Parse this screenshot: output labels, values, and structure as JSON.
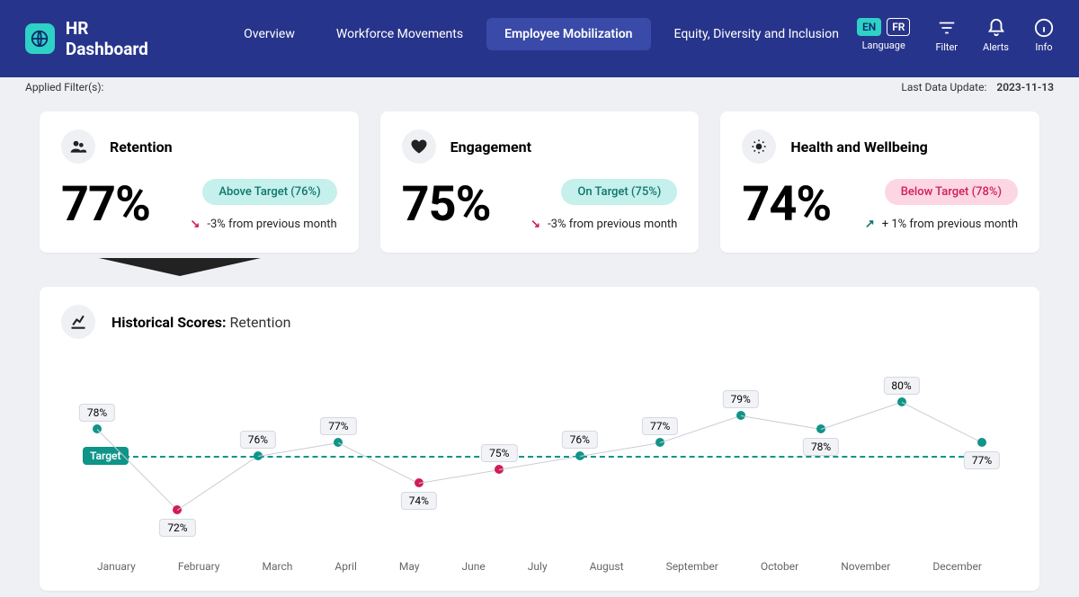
{
  "app_title": "HR Dashboard",
  "nav": {
    "items": [
      "Overview",
      "Workforce Movements",
      "Employee Mobilization",
      "Equity, Diversity and Inclusion"
    ],
    "active_index": 2
  },
  "lang": {
    "en": "EN",
    "fr": "FR",
    "label": "Language"
  },
  "top_icons": {
    "filter": "Filter",
    "alerts": "Alerts",
    "info": "Info"
  },
  "subbar": {
    "applied_label": "Applied Filter(s):",
    "update_label": "Last Data Update:",
    "update_value": "2023-11-13"
  },
  "kpis": [
    {
      "title": "Retention",
      "value": "77%",
      "badge": "Above Target (76%)",
      "badge_class": "above",
      "trend_dir": "down",
      "trend_text": "-3% from previous month",
      "icon": "people"
    },
    {
      "title": "Engagement",
      "value": "75%",
      "badge": "On Target (75%)",
      "badge_class": "on",
      "trend_dir": "down",
      "trend_text": "-3% from previous month",
      "icon": "heart"
    },
    {
      "title": "Health and Wellbeing",
      "value": "74%",
      "badge": "Below Target (78%)",
      "badge_class": "below",
      "trend_dir": "up",
      "trend_text": "+ 1% from previous month",
      "icon": "sun"
    }
  ],
  "chart": {
    "title_prefix": "Historical Scores:",
    "title_metric": "Retention",
    "target_label": "Target"
  },
  "chart_data": {
    "type": "line",
    "title": "Historical Scores: Retention",
    "xlabel": "",
    "ylabel": "",
    "ylim": [
      70,
      82
    ],
    "target": 76,
    "categories": [
      "January",
      "February",
      "March",
      "April",
      "May",
      "June",
      "July",
      "August",
      "September",
      "October",
      "November",
      "December"
    ],
    "values": [
      78,
      72,
      76,
      77,
      74,
      75,
      76,
      77,
      79,
      78,
      80,
      77
    ],
    "label_positions": [
      "above",
      "below",
      "above",
      "above",
      "below",
      "above",
      "above",
      "above",
      "above",
      "below",
      "above",
      "below"
    ]
  }
}
